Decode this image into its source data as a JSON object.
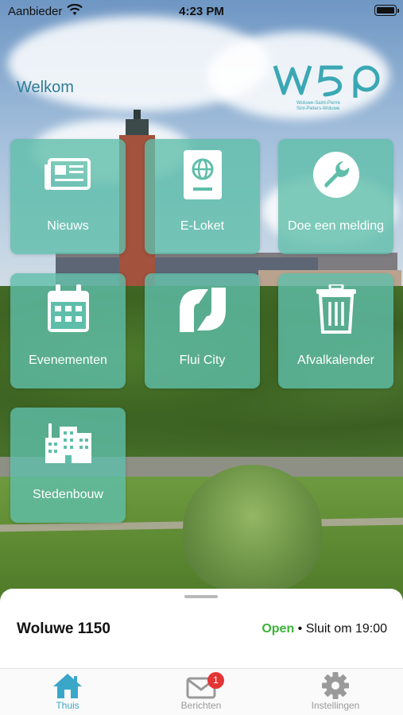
{
  "status_bar": {
    "carrier": "Aanbieder",
    "time": "4:23 PM"
  },
  "header": {
    "welcome": "Welkom",
    "logo_text": "W5P",
    "logo_sub1": "Woluwe-Saint-Pierre",
    "logo_sub2": "Sint-Pieters-Woluwe"
  },
  "tiles": [
    {
      "label": "Nieuws",
      "icon": "newspaper-icon"
    },
    {
      "label": "E-Loket",
      "icon": "passport-icon"
    },
    {
      "label": "Doe een melding",
      "icon": "wrench-icon"
    },
    {
      "label": "Evenementen",
      "icon": "calendar-icon"
    },
    {
      "label": "Flui City",
      "icon": "fluicity-icon"
    },
    {
      "label": "Afvalkalender",
      "icon": "trash-icon"
    },
    {
      "label": "Stedenbouw",
      "icon": "buildings-icon"
    }
  ],
  "location_sheet": {
    "name": "Woluwe 1150",
    "status": "Open",
    "closing": "• Sluit om 19:00"
  },
  "tab_bar": [
    {
      "label": "Thuis",
      "icon": "home-icon",
      "active": true
    },
    {
      "label": "Berichten",
      "icon": "mail-icon",
      "badge": "1",
      "active": false
    },
    {
      "label": "Instellingen",
      "icon": "gear-icon",
      "active": false
    }
  ],
  "colors": {
    "accent": "#3aa7c9",
    "tile": "#5fbeaa",
    "open_green": "#3cb338",
    "badge_red": "#e43535"
  }
}
